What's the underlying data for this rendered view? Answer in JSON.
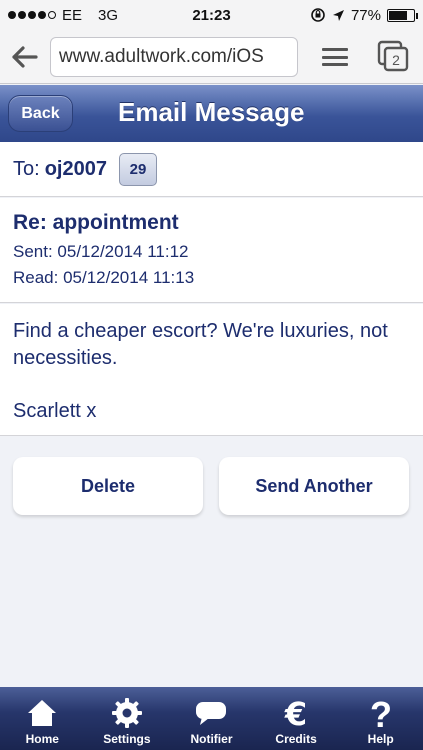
{
  "status_bar": {
    "carrier": "EE",
    "network": "3G",
    "time": "21:23",
    "battery": "77%",
    "battery_level": 0.77
  },
  "browser": {
    "url": "www.adultwork.com/iOS",
    "tab_count": "2"
  },
  "header": {
    "back_label": "Back",
    "title": "Email Message"
  },
  "message": {
    "to_label": "To:",
    "to_name": "oj2007",
    "badge": "29",
    "subject": "Re: appointment",
    "sent": "Sent: 05/12/2014 11:12",
    "read": "Read: 05/12/2014 11:13",
    "body": "Find a cheaper escort? We're luxuries, not necessities.",
    "signoff": "Scarlett x"
  },
  "actions": {
    "delete_label": "Delete",
    "send_another_label": "Send Another"
  },
  "tabbar": {
    "home": "Home",
    "settings": "Settings",
    "notifier": "Notifier",
    "credits": "Credits",
    "help": "Help"
  },
  "colors": {
    "header_blue": "#3a5499",
    "text_navy": "#1d2d6e",
    "tabbar_navy": "#27366b"
  }
}
